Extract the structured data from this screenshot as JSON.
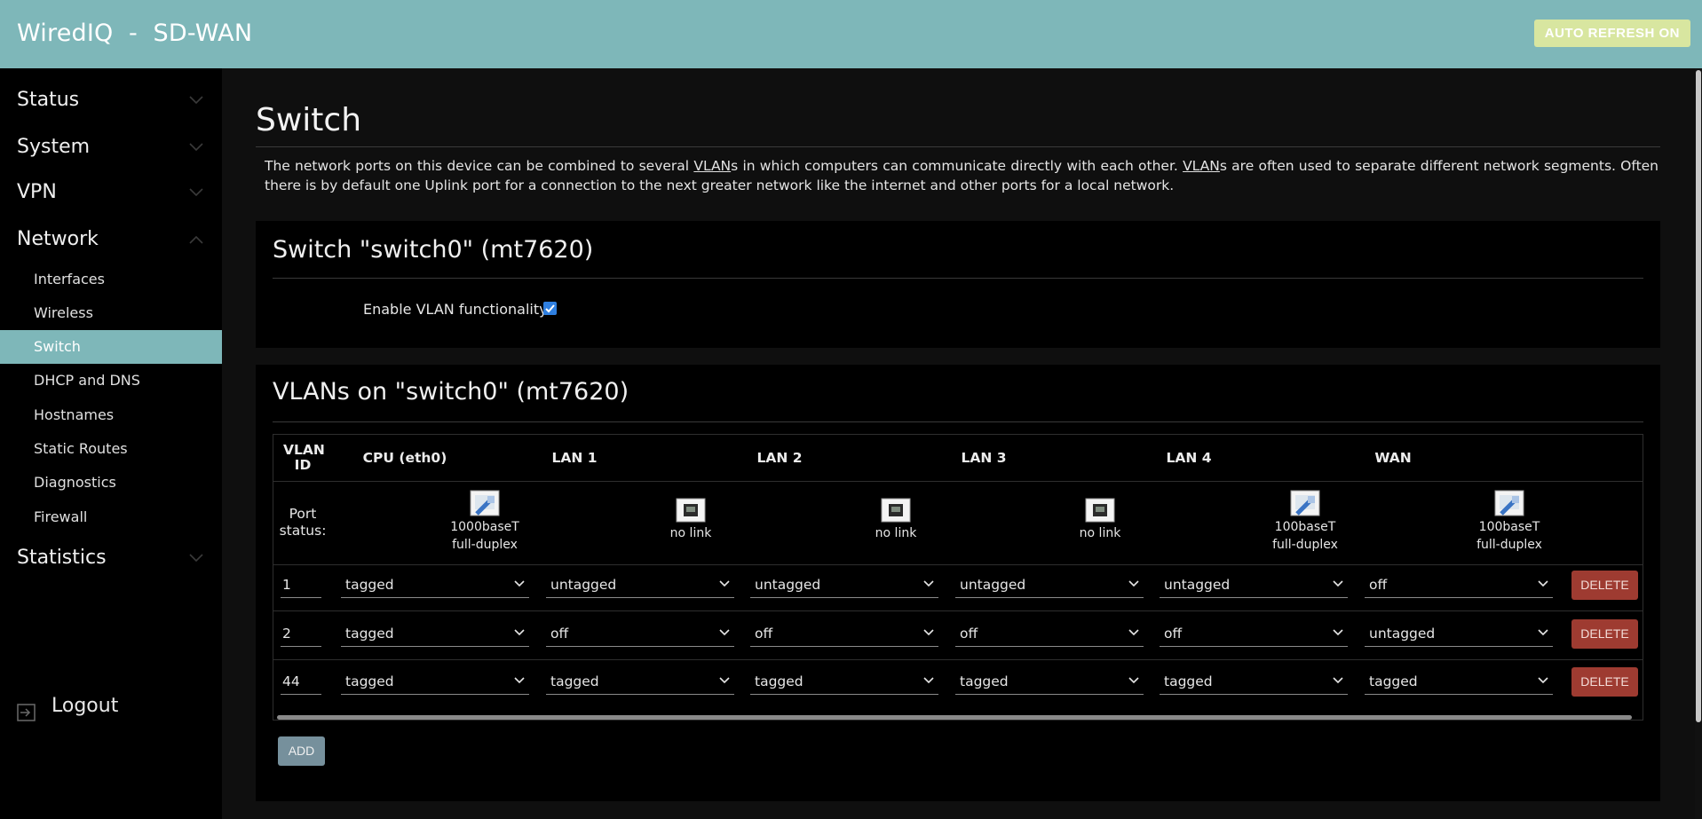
{
  "header": {
    "brand": "WiredIQ  -  SD-WAN",
    "auto_refresh": "AUTO REFRESH ON"
  },
  "sidebar": {
    "status": "Status",
    "system": "System",
    "vpn": "VPN",
    "network": "Network",
    "network_items": [
      "Interfaces",
      "Wireless",
      "Switch",
      "DHCP and DNS",
      "Hostnames",
      "Static Routes",
      "Diagnostics",
      "Firewall"
    ],
    "active_item": "Switch",
    "statistics": "Statistics",
    "logout": "Logout"
  },
  "page": {
    "title": "Switch",
    "intro_1a": "The network ports on this device can be combined to several ",
    "intro_vlan_1": "VLAN",
    "intro_1b": "s in which computers can communicate directly with each other. ",
    "intro_vlan_2": "VLAN",
    "intro_1c": "s are often used to separate different network segments. Often there is by default one Uplink port for a connection to the next greater network like the internet and other ports for a local network."
  },
  "switch_section": {
    "title": "Switch \"switch0\" (mt7620)",
    "vlan_label": "Enable VLAN functionality",
    "vlan_enabled": true
  },
  "vlan_section": {
    "title": "VLANs on \"switch0\" (mt7620)",
    "headers": [
      "VLAN ID",
      "CPU (eth0)",
      "LAN 1",
      "LAN 2",
      "LAN 3",
      "LAN 4",
      "WAN"
    ],
    "port_status_label": "Port status:",
    "ports": [
      {
        "line1": "1000baseT",
        "line2": "full-duplex",
        "icon": "port-connected-icon"
      },
      {
        "line1": "no link",
        "line2": "",
        "icon": "port-disconnected-icon"
      },
      {
        "line1": "no link",
        "line2": "",
        "icon": "port-disconnected-icon"
      },
      {
        "line1": "no link",
        "line2": "",
        "icon": "port-disconnected-icon"
      },
      {
        "line1": "100baseT",
        "line2": "full-duplex",
        "icon": "port-connected-icon"
      },
      {
        "line1": "100baseT",
        "line2": "full-duplex",
        "icon": "port-connected-icon"
      }
    ],
    "rows": [
      {
        "id": "1",
        "values": [
          "tagged",
          "untagged",
          "untagged",
          "untagged",
          "untagged",
          "off"
        ]
      },
      {
        "id": "2",
        "values": [
          "tagged",
          "off",
          "off",
          "off",
          "off",
          "untagged"
        ]
      },
      {
        "id": "44",
        "values": [
          "tagged",
          "tagged",
          "tagged",
          "tagged",
          "tagged",
          "tagged"
        ]
      }
    ],
    "delete_label": "DELETE",
    "add_label": "ADD"
  },
  "colors": {
    "header_bg": "#7eb7b9",
    "active_bg": "#7eb7b9",
    "delete_bg": "#9e3b31",
    "add_bg": "#76909c",
    "checkbox": "#2f7fe0"
  }
}
